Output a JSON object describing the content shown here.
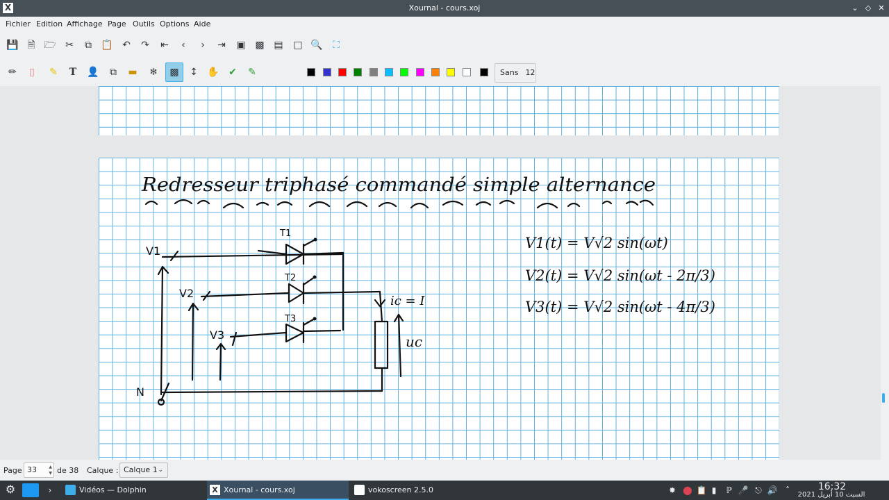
{
  "window": {
    "title": "Xournal - cours.xoj",
    "app_icon": "X"
  },
  "menu": [
    "Fichier",
    "Edition",
    "Affichage",
    "Page",
    "Outils",
    "Options",
    "Aide"
  ],
  "toolbar": {
    "font_name": "Sans",
    "font_size": "12",
    "colors": [
      "#000000",
      "#3333cc",
      "#ff0000",
      "#008000",
      "#808080",
      "#00c0ff",
      "#00ff00",
      "#ff00ff",
      "#ff8000",
      "#ffff00",
      "#ffffff",
      "#000000"
    ]
  },
  "status": {
    "page_label": "Page",
    "page_value": "33",
    "of_label": "de 38",
    "layer_label": "Calque :",
    "layer_value": "Calque 1"
  },
  "note": {
    "title": "Redresseur triphasé commandé simple alternance",
    "labels": {
      "v1": "V1",
      "v2": "V2",
      "v3": "V3",
      "n": "N",
      "t1": "T1",
      "t2": "T2",
      "t3": "T3",
      "ic": "ic = I",
      "uc": "uc"
    },
    "equations": [
      "V1(t) = V√2 sin(ωt)",
      "V2(t) = V√2 sin(ωt - 2π/3)",
      "V3(t) = V√2 sin(ωt - 4π/3)"
    ]
  },
  "taskbar": {
    "tasks": [
      {
        "label": "Vidéos — Dolphin",
        "active": false
      },
      {
        "label": "Xournal - cours.xoj",
        "active": true
      },
      {
        "label": "vokoscreen 2.5.0",
        "active": false
      }
    ],
    "time": "16:32",
    "date": "السبت 10 أبريل 2021"
  }
}
